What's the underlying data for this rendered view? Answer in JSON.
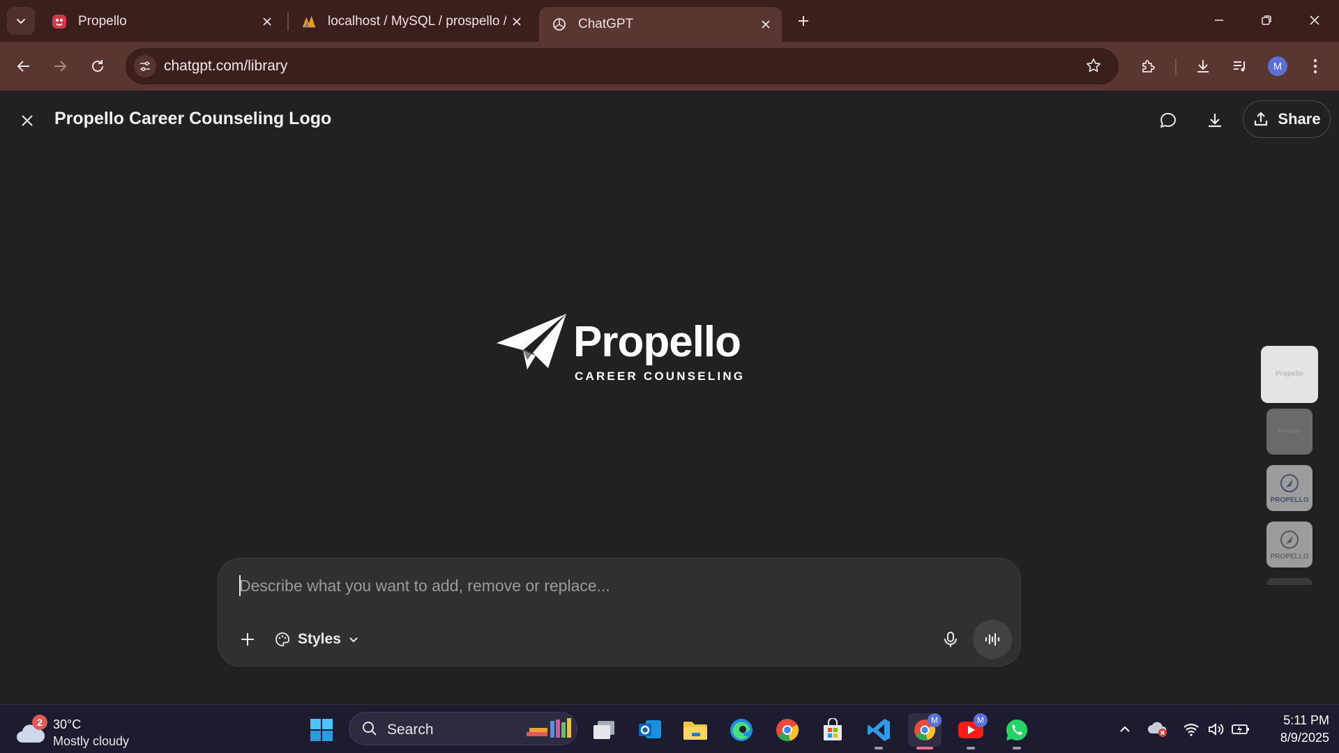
{
  "browser": {
    "tabs": [
      {
        "title": "Propello",
        "icon": "propello-favicon"
      },
      {
        "title": "localhost / MySQL / prospello / ",
        "icon": "phpmyadmin-favicon"
      },
      {
        "title": "ChatGPT",
        "icon": "chatgpt-favicon",
        "active": true
      }
    ],
    "url": "chatgpt.com/library",
    "profile_initial": "M",
    "accent": "#5a3632"
  },
  "viewer": {
    "title": "Propello Career Counseling Logo",
    "share_label": "Share",
    "logo": {
      "wordmark": "Propello",
      "tagline": "CAREER COUNSELING"
    },
    "thumbnails": [
      {
        "label": "Propello",
        "selected": true
      },
      {
        "label": "Propello"
      },
      {
        "label": "PROPELLO"
      },
      {
        "label": "PROPELLO"
      }
    ]
  },
  "composer": {
    "placeholder": "Describe what you want to add, remove or replace...",
    "value": "",
    "styles_label": "Styles"
  },
  "taskbar": {
    "weather": {
      "badge": "2",
      "temp": "30°C",
      "condition": "Mostly cloudy"
    },
    "search_label": "Search",
    "app_badge": "M",
    "time": "5:11 PM",
    "date": "8/9/2025"
  }
}
